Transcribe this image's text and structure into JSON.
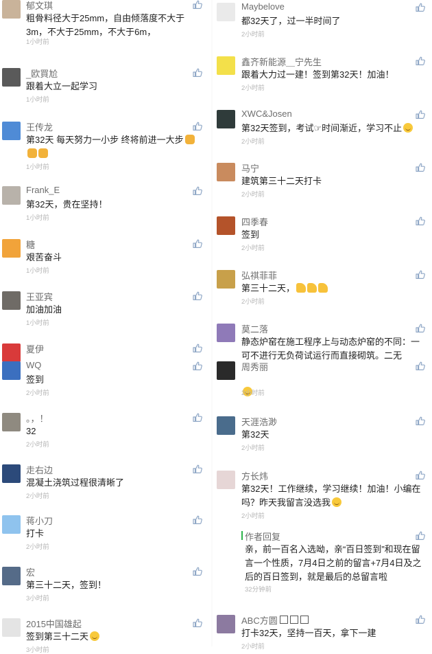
{
  "left": [
    {
      "name": "郁文琪",
      "text": "粗骨料径大于25mm，自由倾落度不大于3m，不大于25mm，不大于6m，",
      "time": "1小时前"
    },
    {
      "name": "_欧買尬",
      "text": "跟着大立一起学习",
      "time": "1小时前"
    },
    {
      "name": "王传龙",
      "text": "第32天 每天努力一小步 终将前进一大步",
      "time": "1小时前"
    },
    {
      "name": "Frank_E",
      "text": "第32天，贵在坚持！",
      "time": "1小时前"
    },
    {
      "name": "糖",
      "text": "艰苦奋斗",
      "time": "1小时前"
    },
    {
      "name": "王亚宾",
      "text": "加油加油",
      "time": "1小时前"
    },
    {
      "name": "夏伊",
      "text": "",
      "time": ""
    },
    {
      "name": "WQ",
      "text": "签到",
      "time": "2小时前"
    },
    {
      "name": "。，！",
      "text": "32",
      "time": "2小时前"
    },
    {
      "name": "走右边",
      "text": "混凝土浇筑过程很清晰了",
      "time": "2小时前"
    },
    {
      "name": "蒋小刀",
      "text": "打卡",
      "time": "2小时前"
    },
    {
      "name": "宏",
      "text": "第三十二天，签到！",
      "time": "3小时前"
    },
    {
      "name": "2015中国雄起",
      "text": "签到第三十二天",
      "time": "3小时前"
    }
  ],
  "right": [
    {
      "name": "Maybelove",
      "text": "都32天了，过一半时间了",
      "time": "2小时前"
    },
    {
      "name": "鑫齐新能源＿宁先生",
      "text": "跟着大力过一建！签到第32天！加油！",
      "time": "2小时前"
    },
    {
      "name": "XWC&Josen",
      "text": "第32天签到，考试☞时间渐近，学习不止",
      "time": "2小时前"
    },
    {
      "name": "马宁",
      "text": "建筑第三十二天打卡",
      "time": "2小时前"
    },
    {
      "name": "四季春",
      "text": "签到",
      "time": "2小时前"
    },
    {
      "name": "弘祺菲菲",
      "text": "第三十二天，",
      "time": "2小时前"
    },
    {
      "name": "莫二落",
      "text": "静态炉窑在施工程序上与动态炉窑的不同：一可不进行无负荷试运行而直接砌筑。二无",
      "time": ""
    },
    {
      "name": "周秀丽",
      "text": "",
      "time": "2小时前"
    },
    {
      "name": "天涯浩渺",
      "text": "第32天",
      "time": "2小时前"
    },
    {
      "name": "方长炜",
      "text": "第32天！工作继续，学习继续！加油！小编在吗？昨天我留言没选我",
      "time": "2小时前"
    },
    {
      "name": "ABC方圆",
      "text": "打卡32天，坚持一百天，拿下一建",
      "time": "2小时前"
    }
  ],
  "author_reply": {
    "title": "作者回复",
    "text": "亲，前一百名入选呦，亲“百日签到”和现在留言一个性质，7月4日之前的留言+7月4日及之后的百日签到，就是最后的总留言啦",
    "time": "32分钟前"
  },
  "colors": {
    "name": "#6d6d6d",
    "time": "#b5b5b5",
    "reply_bar": "#2bb34a",
    "like_icon": "#8fa7c6"
  }
}
